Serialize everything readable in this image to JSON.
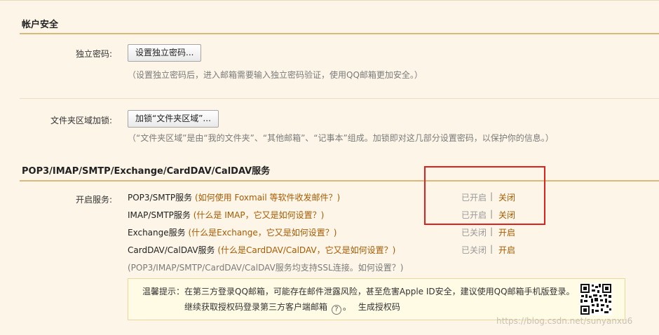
{
  "account_security": {
    "title": "帐户安全",
    "independent_password": {
      "label": "独立密码:",
      "button": "设置独立密码...",
      "hint": "（设置独立密码后，进入邮箱需要输入独立密码验证，使用QQ邮箱更加安全。）"
    },
    "folder_lock": {
      "label": "文件夹区域加锁:",
      "button": "加锁“文件夹区域”...",
      "hint": "（“文件夹区域”是由“我的文件夹”、“其他邮箱”、“记事本”组成。加锁即对这几部分设置密码，以保护你的信息。）"
    }
  },
  "pop3_section": {
    "title": "POP3/IMAP/SMTP/Exchange/CardDAV/CalDAV服务",
    "enable_label": "开启服务:",
    "services": [
      {
        "name": "POP3/SMTP服务",
        "help": "(如何使用 Foxmail 等软件收发邮件？)",
        "status": "已开启",
        "sep": "|",
        "action": "关闭"
      },
      {
        "name": "IMAP/SMTP服务",
        "help": "(什么是 IMAP，它又是如何设置？)",
        "status": "已开启",
        "sep": "|",
        "action": "关闭"
      },
      {
        "name": "Exchange服务",
        "help": "(什么是Exchange，它又是如何设置？)",
        "status": "已关闭",
        "sep": "|",
        "action": "开启"
      },
      {
        "name": "CardDAV/CalDAV服务",
        "help": "(什么是CardDAV/CalDAV，它又是如何设置？)",
        "status": "已关闭",
        "sep": "|",
        "action": "开启"
      }
    ],
    "ssl_note": "(POP3/IMAP/SMTP/CardDAV/CalDAV服务均支持SSL连接。如何设置？)",
    "tip": {
      "line1": "温馨提示：在第三方登录QQ邮箱，可能存在邮件泄露风险，甚至危害Apple ID安全，建议使用QQ邮箱手机版登录。",
      "line2": "继续获取授权码登录第三方客户端邮箱",
      "help_glyph": "?",
      "period": "。",
      "link": "生成授权码"
    }
  },
  "watermark": "https://blog.csdn.net/sunyanxu6",
  "colors": {
    "accent": "#a65a00",
    "highlight_box": "#e0201c",
    "section_rule": "#d9b87a",
    "background": "#fdf6e8"
  }
}
